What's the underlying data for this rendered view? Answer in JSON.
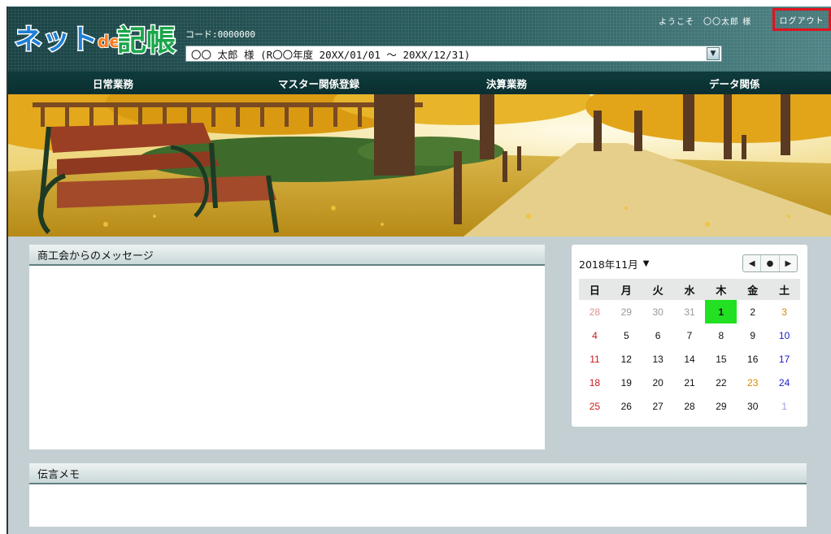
{
  "header": {
    "logo_text": "ネットde記帳",
    "code_label": "コード:0000000",
    "user_select_value": "〇〇 太郎 様 (R〇〇年度 20XX/01/01 ～ 20XX/12/31)",
    "welcome": "ようこそ　〇〇太郎 様",
    "logout": "ログアウト"
  },
  "nav": {
    "items": [
      "日常業務",
      "マスター関係登録",
      "決算業務",
      "データ関係"
    ]
  },
  "message_panel": {
    "title": "商工会からのメッセージ"
  },
  "memo_panel": {
    "title": "伝言メモ"
  },
  "calendar": {
    "month_label": "2018年11月",
    "dropdown_icon": "caret-down-icon",
    "nav": {
      "prev": "◀",
      "today": "●",
      "next": "▶"
    },
    "weekdays": [
      "日",
      "月",
      "火",
      "水",
      "木",
      "金",
      "土"
    ],
    "weeks": [
      [
        "28",
        "29",
        "30",
        "31",
        "1",
        "2",
        "3"
      ],
      [
        "4",
        "5",
        "6",
        "7",
        "8",
        "9",
        "10"
      ],
      [
        "11",
        "12",
        "13",
        "14",
        "15",
        "16",
        "17"
      ],
      [
        "18",
        "19",
        "20",
        "21",
        "22",
        "23",
        "24"
      ],
      [
        "25",
        "26",
        "27",
        "28",
        "29",
        "30",
        "1"
      ]
    ],
    "today": "1",
    "colors": {
      "today": "#22e022",
      "sunday": "#cc1a1a",
      "saturday": "#1a1acc",
      "holiday": "#d48a00"
    }
  }
}
